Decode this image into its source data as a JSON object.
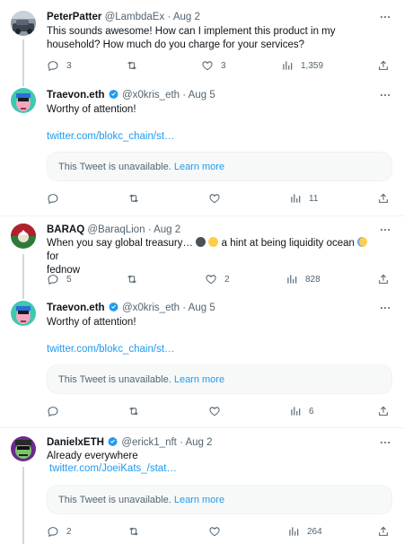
{
  "tweets": [
    {
      "name": "PeterPatter",
      "handle": "@LambdaEx",
      "date": "Aug 2",
      "verified": false,
      "text": "This sounds awesome! How can I implement this product in my household? How much do you charge for your services?",
      "replies": "3",
      "retweets": "",
      "likes": "3",
      "views": "1,359"
    },
    {
      "name": "Traevon.eth",
      "handle": "@x0kris_eth",
      "date": "Aug 5",
      "verified": true,
      "text": "Worthy of attention!",
      "link": "twitter.com/blokc_chain/st…",
      "card_text": "This Tweet is unavailable.",
      "card_link": "Learn more",
      "replies": "",
      "retweets": "",
      "likes": "",
      "views": "11"
    },
    {
      "name": "BARAQ",
      "handle": "@BaraqLion",
      "date": "Aug 2",
      "verified": false,
      "text_a": "When you say global treasury…",
      "text_b": "a hint at being liquidity ocean",
      "text_c": "for",
      "text_d": "fednow",
      "replies": "5",
      "retweets": "",
      "likes": "2",
      "views": "828"
    },
    {
      "name": "Traevon.eth",
      "handle": "@x0kris_eth",
      "date": "Aug 5",
      "verified": true,
      "text": "Worthy of attention!",
      "link": "twitter.com/blokc_chain/st…",
      "card_text": "This Tweet is unavailable.",
      "card_link": "Learn more",
      "replies": "",
      "retweets": "",
      "likes": "",
      "views": "6"
    },
    {
      "name": "DanielxETH",
      "handle": "@erick1_nft",
      "date": "Aug 2",
      "verified": true,
      "text": "Already everywhere",
      "link": "twitter.com/JoeiKats_/stat…",
      "card_text": "This Tweet is unavailable.",
      "card_link": "Learn more",
      "replies": "2",
      "retweets": "",
      "likes": "",
      "views": "264"
    }
  ],
  "colors": {
    "accent": "#1d9bf0",
    "muted": "#536471",
    "verified": "#1d9bf0"
  },
  "icons": [
    "reply-icon",
    "retweet-icon",
    "like-icon",
    "views-icon",
    "share-icon",
    "more-icon",
    "verified-badge-icon"
  ]
}
